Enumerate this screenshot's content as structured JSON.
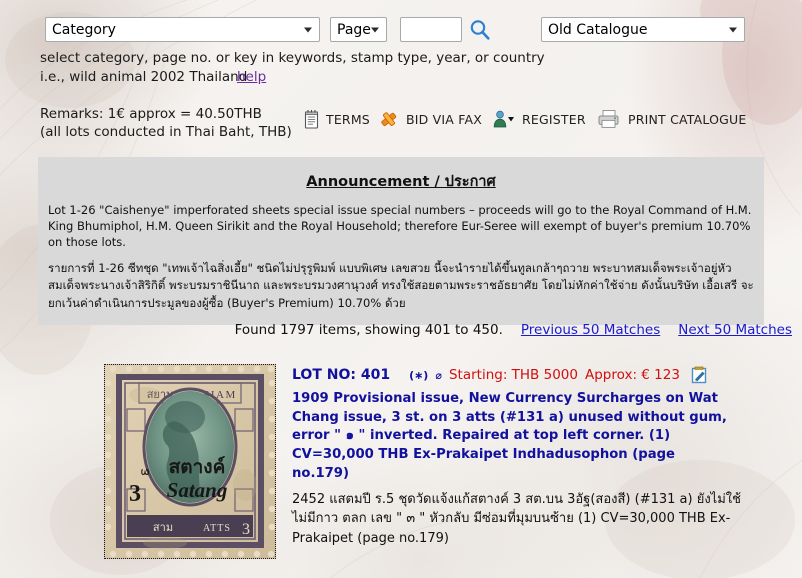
{
  "search": {
    "category_label": "Category",
    "page_label": "Page",
    "keyword_value": "",
    "keyword_placeholder": "",
    "catalogue_label": "Old Catalogue",
    "search_icon": "search-icon",
    "hint_line_1": "select category, page no. or key in keywords, stamp type, year, or country",
    "hint_line_2": "i.e., wild animal 2002 Thailand",
    "help_label": "help"
  },
  "remarks": {
    "line_1": "Remarks: 1€ approx = 40.50THB",
    "line_2": "(all lots conducted in Thai Baht, THB)"
  },
  "toolbar": {
    "items": [
      {
        "label": "TERMS",
        "icon": "notepad-icon"
      },
      {
        "label": "BID VIA FAX",
        "icon": "gavel-icon"
      },
      {
        "label": "REGISTER",
        "icon": "user-icon"
      },
      {
        "label": "PRINT CATALOGUE",
        "icon": "printer-icon"
      }
    ]
  },
  "announcement": {
    "title": "Announcement / ประกาศ",
    "paragraph_en": "Lot 1-26 \"Caishenye\" imperforated sheets special issue special numbers – proceeds will go to the Royal Command of H.M. King Bhumiphol, H.M. Queen Sirikit and the Royal Household; therefore Eur-Seree will exempt of buyer's premium 10.70% on those lots.",
    "paragraph_th": "รายการที่ 1-26 ซีทชุด \"เทพเจ้าไฉสิ่งเอี้ย\" ชนิดไม่ปรุรูพิมพ์ แบบพิเศษ เลขสวย นี้จะนำรายได้ขึ้นทูลเกล้าๆถวาย พระบาทสมเด็จพระเจ้าอยู่หัว สมเด็จพระนางเจ้าสิริกิติ์ พระบรมราชินีนาถ และพระบรมวงศานุวงศ์ ทรงใช้สอยตามพระราชอัธยาศัย โดยไม่หักค่าใช้จ่าย ดังนั้นบริษัท เอื้อเสรี จะยกเว้นค่าดำเนินการประมูลของผู้ซื้อ (Buyer's Premium) 10.70% ด้วย"
  },
  "results": {
    "found_text": "Found 1797 items, showing 401 to 450.",
    "prev_label": "Previous 50 Matches",
    "next_label": "Next 50 Matches"
  },
  "lot": {
    "lot_no_label": "LOT NO: 401",
    "badge_star": "(∗)",
    "badge_circle": "⌀",
    "starting_label": "Starting: THB 5000",
    "approx_label": "Approx: € 123",
    "note_icon": "edit-note-icon",
    "description_en": "1909 Provisional issue, New Currency Surcharges on Wat Chang issue, 3 st. on 3 atts (#131 a) unused without gum, error \" ๑ \" inverted. Repaired at top left corner. (1) CV=30,000 THB Ex-Prakaipet Indhadusophon (page no.179)",
    "description_th": "2452 แสตมปี ร.5 ชุดวัดแจ้งแก้สตางค์ 3 สต.บน 3อัฐ(สองสี) (#131 a) ยังไม่ใช้ ไม่มีกาว ตลก เลข \" ๓ \" หัวกลับ มีซ่อมที่มุมบนซ้าย (1) CV=30,000 THB Ex-Prakaipet (page no.179)",
    "stamp_image": {
      "country_top_left": "สยาม",
      "country_top_right": "SIAM",
      "overprint_thai": "สตางค์",
      "overprint_latin": "Satang",
      "value_left": "3",
      "value_bottom_right": "3",
      "bottom_thai": "สาม",
      "bottom_latin": "ATTS"
    }
  },
  "colors": {
    "link": "#1a1ad1",
    "lot_blue": "#11119e",
    "price_red": "#d01010",
    "help_purple": "#6a2f9c",
    "announce_bg": "#d9d9d9",
    "page_bg": "#f4f1ee"
  }
}
